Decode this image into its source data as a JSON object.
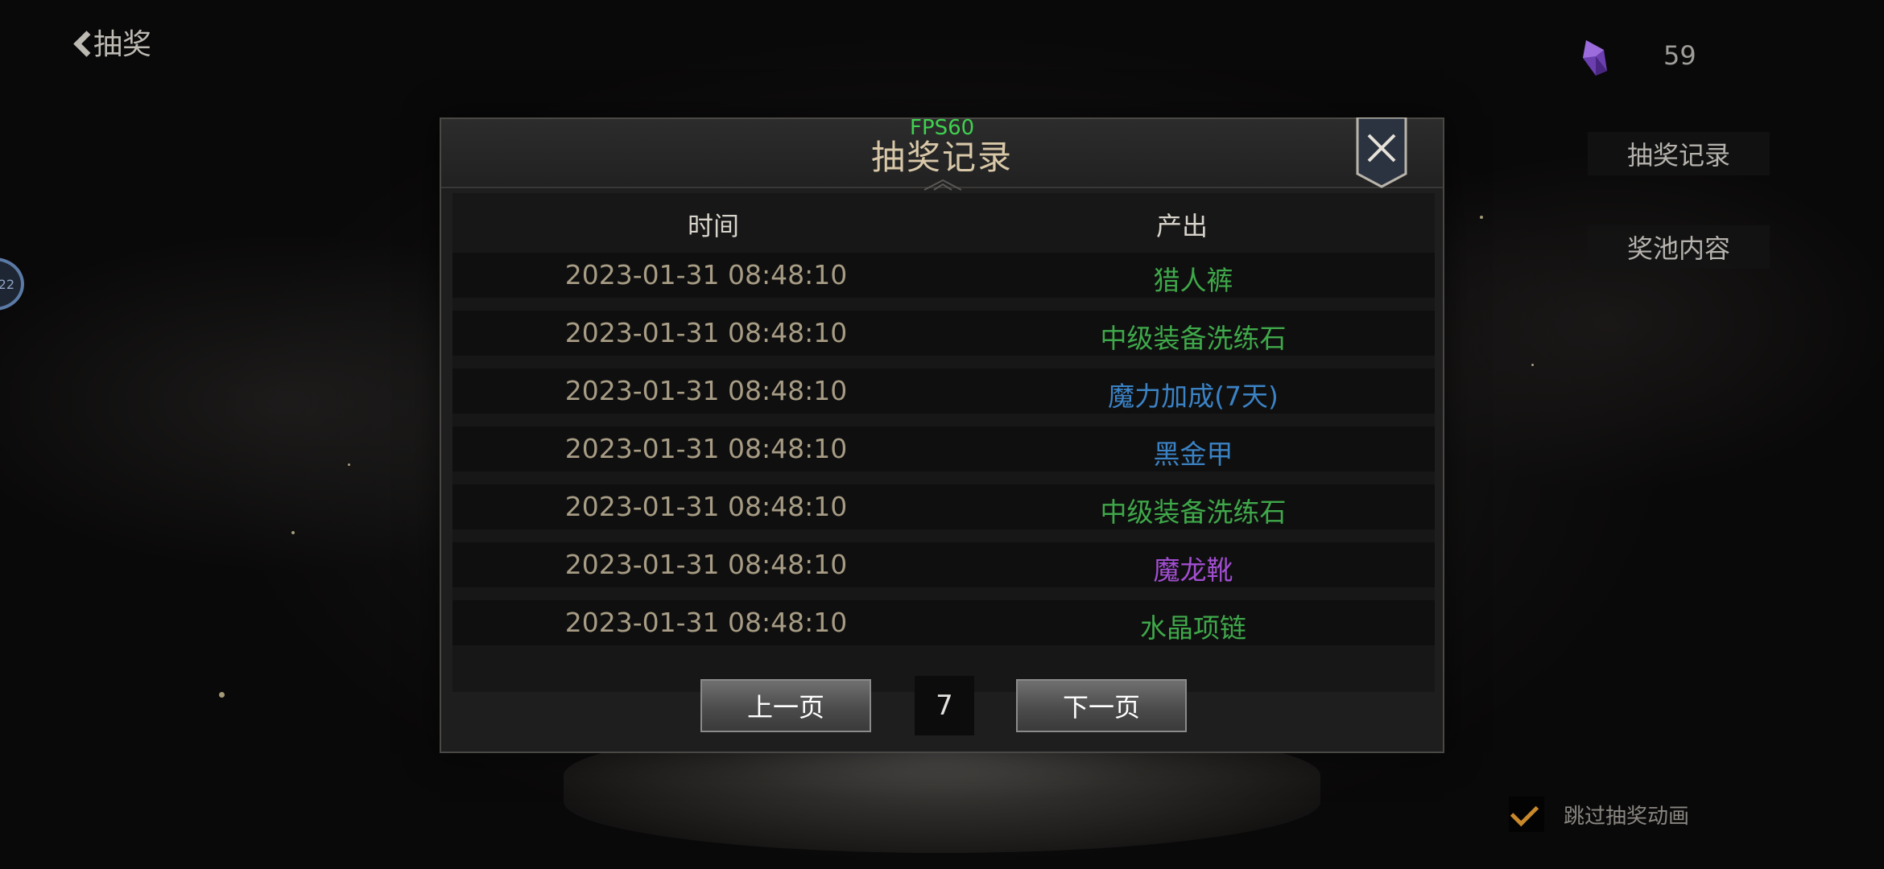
{
  "header": {
    "back_label": "抽奖"
  },
  "currency": {
    "icon": "purple-crystal-icon",
    "count": "59"
  },
  "side_buttons": {
    "record": "抽奖记录",
    "pool": "奖池内容"
  },
  "avatar_text": "22",
  "skip": {
    "label": "跳过抽奖动画",
    "checked": true
  },
  "modal": {
    "title": "抽奖记录",
    "fps": "FPS60",
    "columns": {
      "time": "时间",
      "output": "产出"
    },
    "rows": [
      {
        "time": "2023-01-31 08:48:10",
        "output": "猎人裤",
        "color": "#3fa84a"
      },
      {
        "time": "2023-01-31 08:48:10",
        "output": "中级装备洗练石",
        "color": "#3fa84a"
      },
      {
        "time": "2023-01-31 08:48:10",
        "output": "魔力加成(7天)",
        "color": "#3b82c4"
      },
      {
        "time": "2023-01-31 08:48:10",
        "output": "黑金甲",
        "color": "#3b82c4"
      },
      {
        "time": "2023-01-31 08:48:10",
        "output": "中级装备洗练石",
        "color": "#3fa84a"
      },
      {
        "time": "2023-01-31 08:48:10",
        "output": "魔龙靴",
        "color": "#a24ed1"
      },
      {
        "time": "2023-01-31 08:48:10",
        "output": "水晶项链",
        "color": "#3fa84a"
      }
    ],
    "pager": {
      "prev": "上一页",
      "page": "7",
      "next": "下一页"
    }
  }
}
